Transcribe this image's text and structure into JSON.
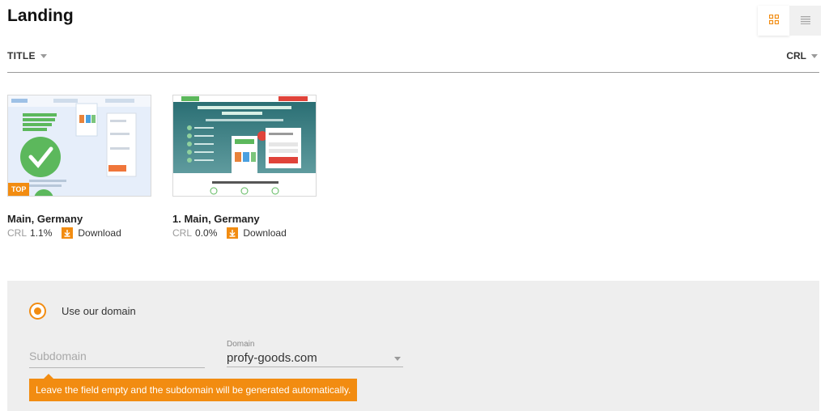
{
  "page": {
    "title": "Landing"
  },
  "view_toggle": {
    "active": "grid-icon",
    "inactive": "list-icon"
  },
  "sort": {
    "title_label": "TITLE",
    "crl_label": "CRL"
  },
  "cards": [
    {
      "title": "Main, Germany",
      "crl_label": "CRL",
      "crl_value": "1.1%",
      "download_label": "Download",
      "badge": "TOP"
    },
    {
      "title": "1. Main, Germany",
      "crl_label": "CRL",
      "crl_value": "0.0%",
      "download_label": "Download"
    }
  ],
  "domain_panel": {
    "radio_label": "Use our domain",
    "subdomain_placeholder": "Subdomain",
    "domain_label": "Domain",
    "domain_value": "profy-goods.com",
    "hint": "Leave the field empty and the subdomain will be generated automatically."
  },
  "colors": {
    "accent": "#f28c11",
    "panel_bg": "#eeeeee"
  }
}
